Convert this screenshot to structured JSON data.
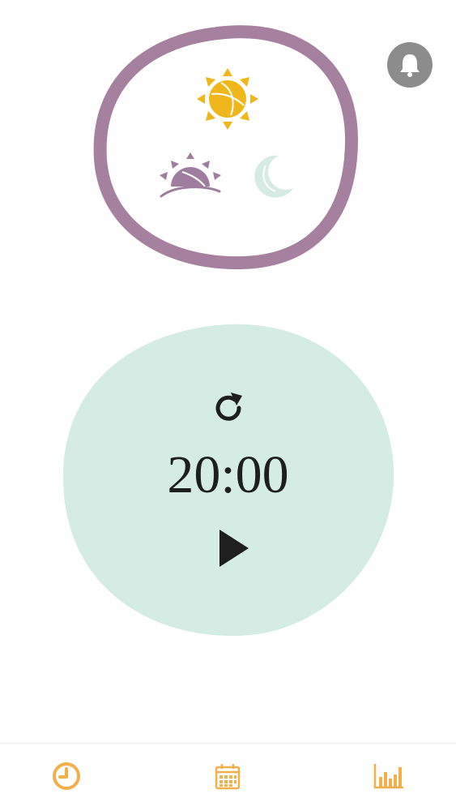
{
  "time_of_day": {
    "options": [
      {
        "icon": "sun-icon",
        "color": "#f0b71c",
        "selected": true
      },
      {
        "icon": "sunrise-icon",
        "color": "#9e7d9e",
        "selected": false
      },
      {
        "icon": "moon-icon",
        "color": "#d5ebe3",
        "selected": false
      }
    ],
    "ring_color": "#a6819f"
  },
  "notifications": {
    "icon": "bell-icon",
    "color": "#8c8c8c"
  },
  "timer": {
    "display": "20:00",
    "blob_color": "#d4ece3",
    "reset_icon": "refresh-icon",
    "play_icon": "play-icon"
  },
  "bottom_nav": {
    "accent": "#f3b04a",
    "items": [
      {
        "icon": "clock-icon",
        "active": true
      },
      {
        "icon": "calendar-icon",
        "active": false
      },
      {
        "icon": "bar-chart-icon",
        "active": false
      }
    ]
  }
}
